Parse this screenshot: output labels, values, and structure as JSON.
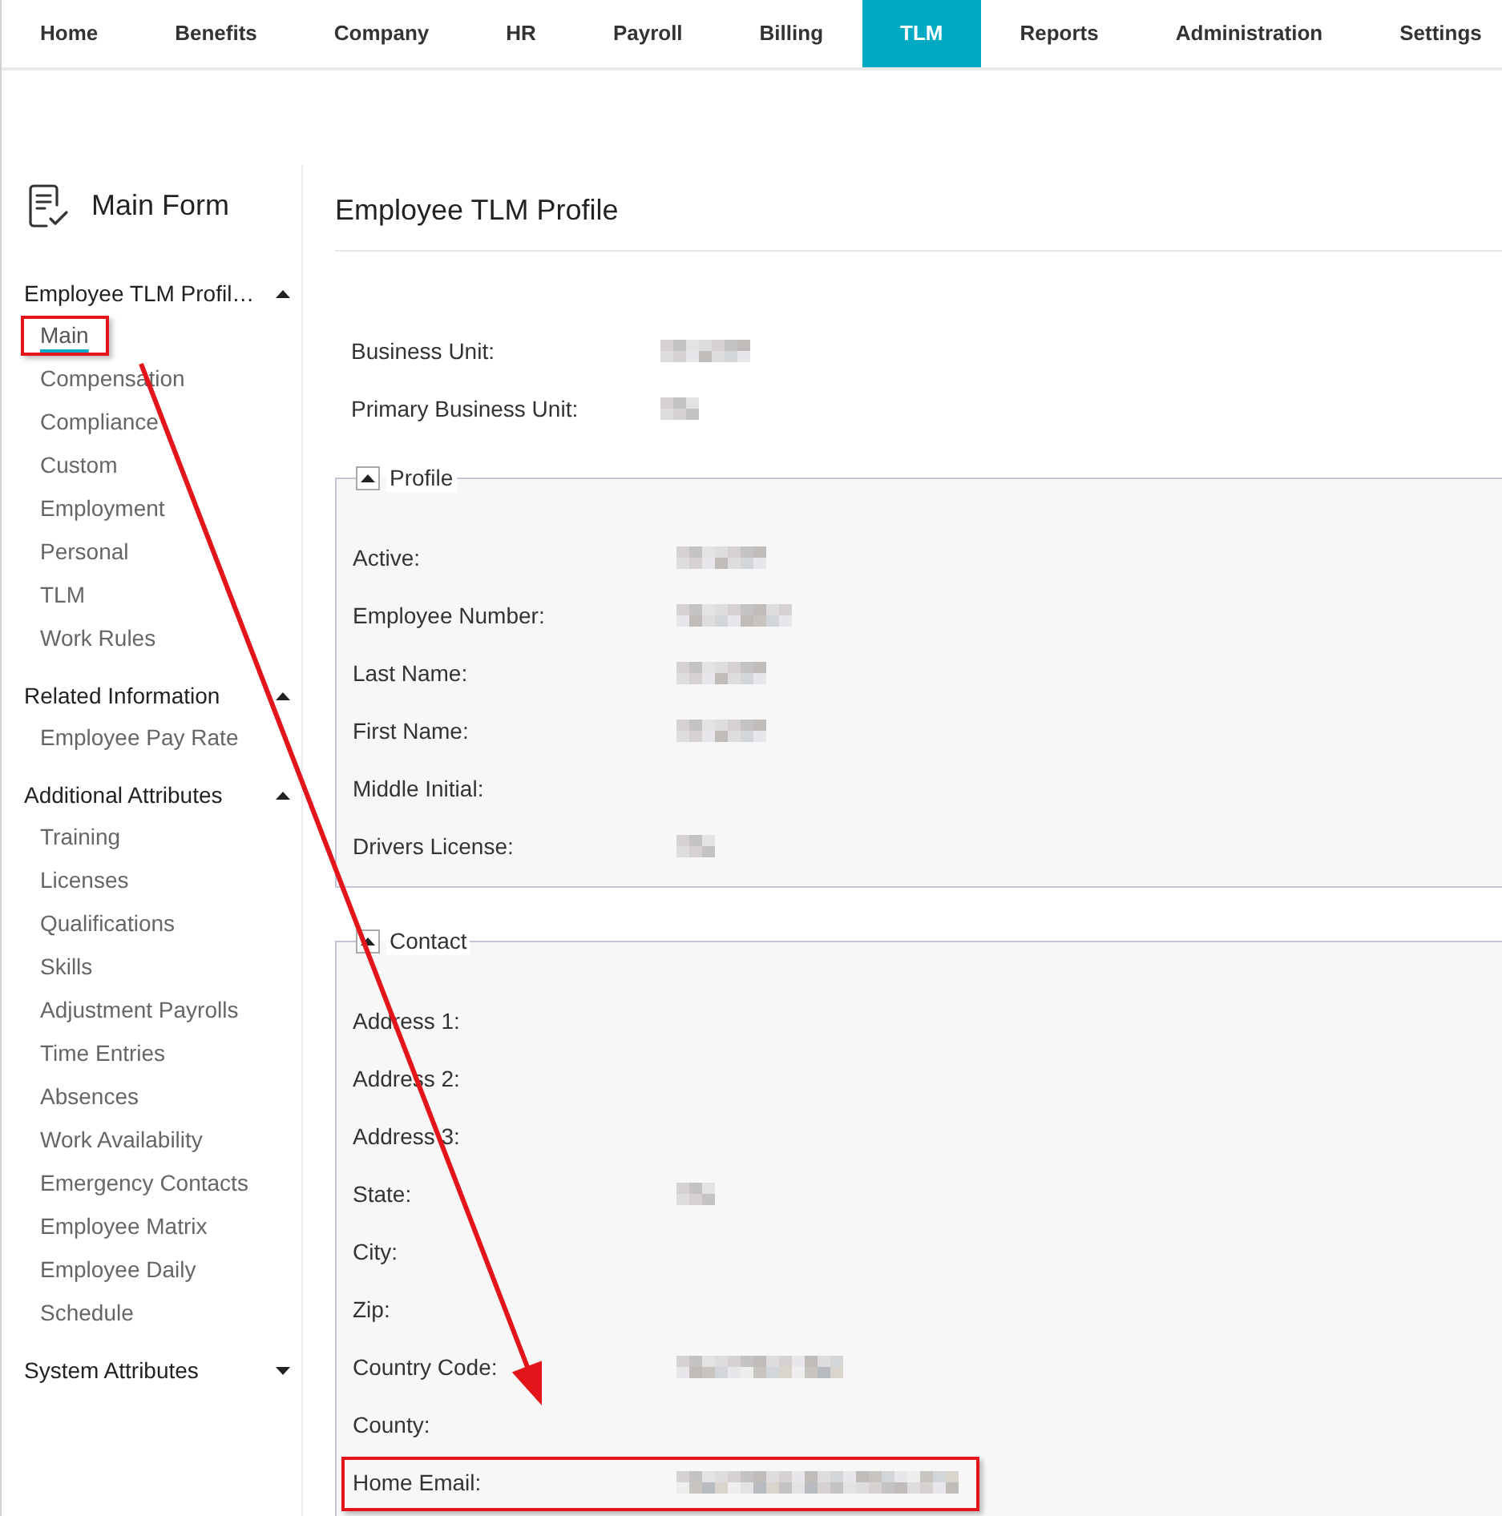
{
  "nav": {
    "tabs": [
      {
        "label": "Home",
        "selected": false
      },
      {
        "label": "Benefits",
        "selected": false
      },
      {
        "label": "Company",
        "selected": false
      },
      {
        "label": "HR",
        "selected": false
      },
      {
        "label": "Payroll",
        "selected": false
      },
      {
        "label": "Billing",
        "selected": false
      },
      {
        "label": "TLM",
        "selected": true
      },
      {
        "label": "Reports",
        "selected": false
      },
      {
        "label": "Administration",
        "selected": false
      },
      {
        "label": "Settings",
        "selected": false
      }
    ]
  },
  "sidebar": {
    "title": "Main Form",
    "sections": [
      {
        "title": "Employee TLM Profil…",
        "expanded": true,
        "items": [
          {
            "label": "Main",
            "selected": true,
            "highlighted": true
          },
          {
            "label": "Compensation",
            "selected": false,
            "highlighted": false
          },
          {
            "label": "Compliance",
            "selected": false,
            "highlighted": false
          },
          {
            "label": "Custom",
            "selected": false,
            "highlighted": false
          },
          {
            "label": "Employment",
            "selected": false,
            "highlighted": false
          },
          {
            "label": "Personal",
            "selected": false,
            "highlighted": false
          },
          {
            "label": "TLM",
            "selected": false,
            "highlighted": false
          },
          {
            "label": "Work Rules",
            "selected": false,
            "highlighted": false
          }
        ]
      },
      {
        "title": "Related Information",
        "expanded": true,
        "items": [
          {
            "label": "Employee Pay Rate",
            "selected": false,
            "highlighted": false
          }
        ]
      },
      {
        "title": "Additional Attributes",
        "expanded": true,
        "items": [
          {
            "label": "Training",
            "selected": false,
            "highlighted": false
          },
          {
            "label": "Licenses",
            "selected": false,
            "highlighted": false
          },
          {
            "label": "Qualifications",
            "selected": false,
            "highlighted": false
          },
          {
            "label": "Skills",
            "selected": false,
            "highlighted": false
          },
          {
            "label": "Adjustment Payrolls",
            "selected": false,
            "highlighted": false
          },
          {
            "label": "Time Entries",
            "selected": false,
            "highlighted": false
          },
          {
            "label": "Absences",
            "selected": false,
            "highlighted": false
          },
          {
            "label": "Work Availability",
            "selected": false,
            "highlighted": false
          },
          {
            "label": "Emergency Contacts",
            "selected": false,
            "highlighted": false
          },
          {
            "label": "Employee Matrix",
            "selected": false,
            "highlighted": false
          },
          {
            "label": "Employee Daily Schedule",
            "selected": false,
            "highlighted": false
          }
        ]
      },
      {
        "title": "System Attributes",
        "expanded": false
      }
    ]
  },
  "page": {
    "title": "Employee TLM Profile",
    "fields": [
      {
        "label": "Business Unit:",
        "kind": "medium",
        "highlighted": false
      },
      {
        "label": "Primary Business Unit:",
        "kind": "short",
        "highlighted": false
      }
    ],
    "fieldsets": [
      {
        "legend": "Profile",
        "expanded": true,
        "fields": [
          {
            "label": "Active:",
            "kind": "medium",
            "highlighted": false
          },
          {
            "label": "Employee Number:",
            "kind": "long",
            "highlighted": false
          },
          {
            "label": "Last Name:",
            "kind": "medium",
            "highlighted": false
          },
          {
            "label": "First Name:",
            "kind": "medium",
            "highlighted": false
          },
          {
            "label": "Middle Initial:",
            "kind": "blank",
            "highlighted": false
          },
          {
            "label": "Drivers License:",
            "kind": "short",
            "highlighted": false
          }
        ]
      },
      {
        "legend": "Contact",
        "expanded": true,
        "fields": [
          {
            "label": "Address 1:",
            "kind": "blank",
            "highlighted": false
          },
          {
            "label": "Address 2:",
            "kind": "blank",
            "highlighted": false
          },
          {
            "label": "Address 3:",
            "kind": "blank",
            "highlighted": false
          },
          {
            "label": "State:",
            "kind": "short",
            "highlighted": false
          },
          {
            "label": "City:",
            "kind": "blank",
            "highlighted": false
          },
          {
            "label": "Zip:",
            "kind": "blank",
            "highlighted": false
          },
          {
            "label": "Country Code:",
            "kind": "wide",
            "highlighted": false
          },
          {
            "label": "County:",
            "kind": "blank",
            "highlighted": false
          },
          {
            "label": "Home Email:",
            "kind": "widest",
            "highlighted": true
          }
        ]
      }
    ]
  }
}
